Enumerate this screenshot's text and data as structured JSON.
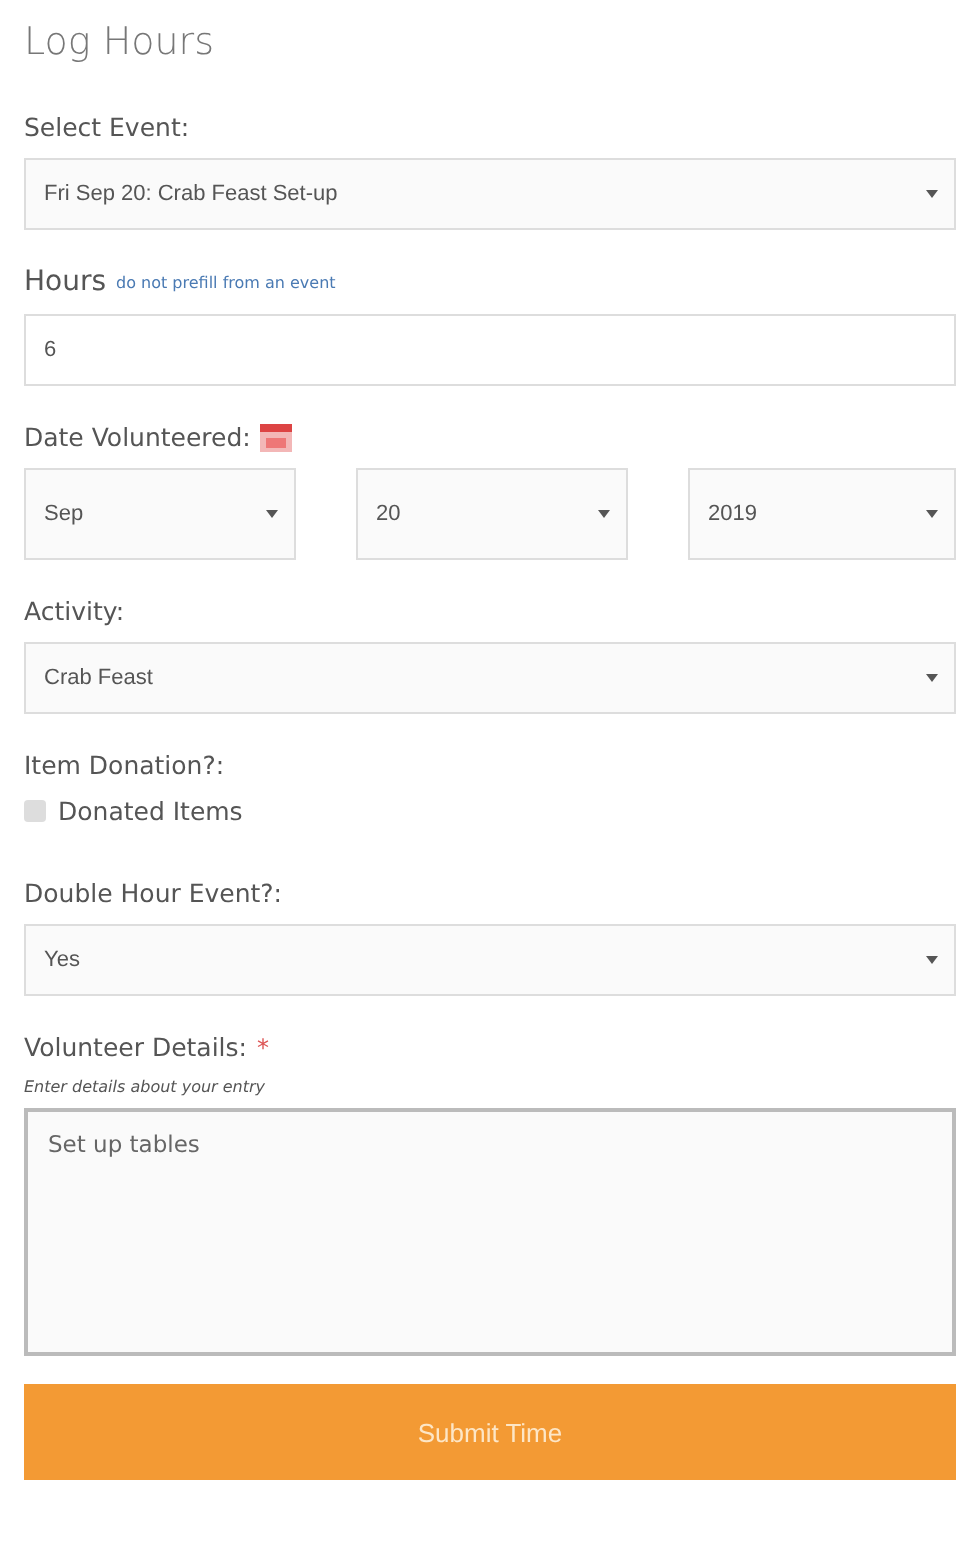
{
  "title": "Log Hours",
  "event": {
    "label": "Select Event:",
    "value": "Fri Sep 20: Crab Feast Set-up"
  },
  "hours": {
    "label": "Hours",
    "link": "do not prefill from an event",
    "value": "6"
  },
  "date": {
    "label": "Date Volunteered:",
    "parts": [
      "Sep",
      "20",
      "2019"
    ]
  },
  "activity": {
    "label": "Activity:",
    "value": "Crab Feast"
  },
  "donation": {
    "label": "Item Donation?:",
    "option": "Donated Items",
    "checked": false
  },
  "double_hour": {
    "label": "Double Hour Event?:",
    "value": "Yes"
  },
  "details": {
    "label": "Volunteer Details:",
    "required_mark": "*",
    "hint": "Enter details about your entry",
    "value": "Set up tables"
  },
  "submit": "Submit Time"
}
